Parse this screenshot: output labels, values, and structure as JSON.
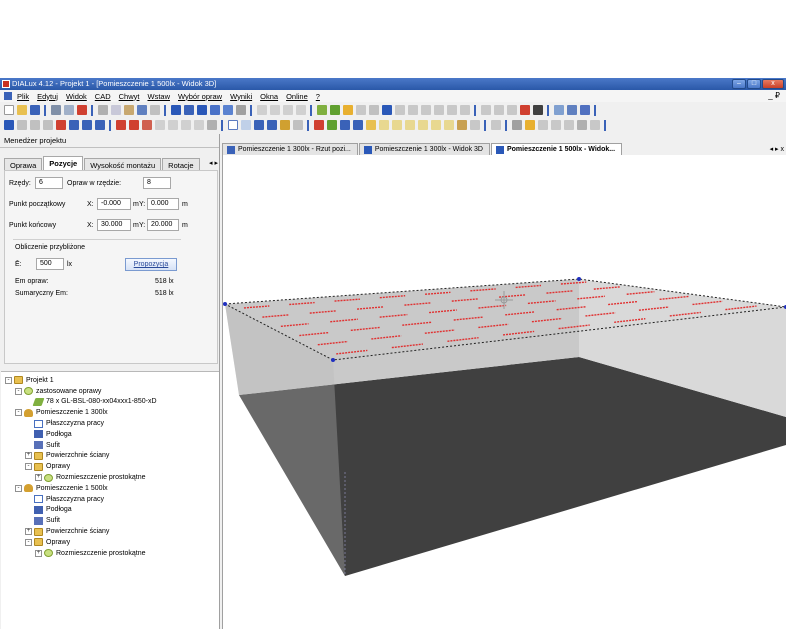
{
  "window": {
    "title": "DIALux 4.12 - Projekt 1 - [Pomieszczenie 1 500lx - Widok 3D]",
    "btn_minimize": "–",
    "btn_maximize": "□",
    "btn_close": "x"
  },
  "menu": {
    "items": [
      "Plik",
      "Edytuj",
      "Widok",
      "CAD",
      "Chwyt",
      "Wstaw",
      "Wybór opraw",
      "Wyniki",
      "Okna",
      "Online",
      "?"
    ],
    "right": "_ ₽"
  },
  "left_panel": {
    "header": "Menedżer projektu",
    "tabs": [
      "Oprawa",
      "Pozycje",
      "Wysokość montażu",
      "Rotacje"
    ],
    "active_tab": "Pozycje",
    "tab_arrows": "◂ ▸",
    "rows_label": "Rzędy:",
    "rows_value": "6",
    "per_row_label": "Opraw w rzędzie:",
    "per_row_value": "8",
    "start_label": "Punkt początkowy",
    "start_x_label": "X:",
    "start_x": "-0.000",
    "start_m": "m",
    "start_y_label": "Y:",
    "start_y": "0.000",
    "start_unit": "m",
    "end_label": "Punkt końcowy",
    "end_x_label": "X:",
    "end_x": "30.000",
    "end_m": "m",
    "end_y_label": "Y:",
    "end_y": "20.000",
    "end_unit": "m",
    "calc_title": "Obliczenie przybliżone",
    "e_label": "Ē:",
    "e_value": "500",
    "e_unit": "lx",
    "propose_button": "Propozycja",
    "em_label": "Em opraw:",
    "em_value": "518 lx",
    "sum_label": "Sumaryczny Em:",
    "sum_value": "518 lx"
  },
  "tree": {
    "items": [
      {
        "label": "Projekt 1",
        "toggle": "-",
        "icon": "folder"
      },
      {
        "label": "zastosowane oprawy",
        "toggle": "-",
        "icon": "arr"
      },
      {
        "label": "78 x GL-BSL-080-xx04xxx1-850-xD",
        "toggle": "",
        "icon": "lum"
      },
      {
        "label": "Pomieszczenie 1 300lx",
        "toggle": "-",
        "icon": "room"
      },
      {
        "label": "Płaszczyzna pracy",
        "toggle": "",
        "icon": "plane"
      },
      {
        "label": "Podłoga",
        "toggle": "",
        "icon": "floor"
      },
      {
        "label": "Sufit",
        "toggle": "",
        "icon": "ceil"
      },
      {
        "label": "Powierzchnie ściany",
        "toggle": "+",
        "icon": "folder"
      },
      {
        "label": "Oprawy",
        "toggle": "-",
        "icon": "folder"
      },
      {
        "label": "Rozmieszczenie prostokątne",
        "toggle": "+",
        "icon": "arr"
      },
      {
        "label": "Pomieszczenie 1 500lx",
        "toggle": "-",
        "icon": "room"
      },
      {
        "label": "Płaszczyzna pracy",
        "toggle": "",
        "icon": "plane"
      },
      {
        "label": "Podłoga",
        "toggle": "",
        "icon": "floor"
      },
      {
        "label": "Sufit",
        "toggle": "",
        "icon": "ceil"
      },
      {
        "label": "Powierzchnie ściany",
        "toggle": "+",
        "icon": "folder"
      },
      {
        "label": "Oprawy",
        "toggle": "-",
        "icon": "folder"
      },
      {
        "label": "Rozmieszczenie prostokątne",
        "toggle": "+",
        "icon": "arr"
      }
    ]
  },
  "doc_tabs": {
    "items": [
      "Pomieszczenie 1 300lx - Rzut pozi...",
      "Pomieszczenie 1 300lx - Widok 3D",
      "Pomieszczenie 1 500lx - Widok..."
    ],
    "active": 2,
    "arrows": "◂ ▸ x"
  },
  "colors": {
    "titlebar": "#2a58a8",
    "floor": "#404040",
    "wall_back": "#c8c8c8",
    "wall_right": "#d4d4d4",
    "luminaire": "#e03030",
    "accent": "#3a62b8"
  },
  "luminaires": {
    "rows": 6,
    "per_row": 8
  }
}
